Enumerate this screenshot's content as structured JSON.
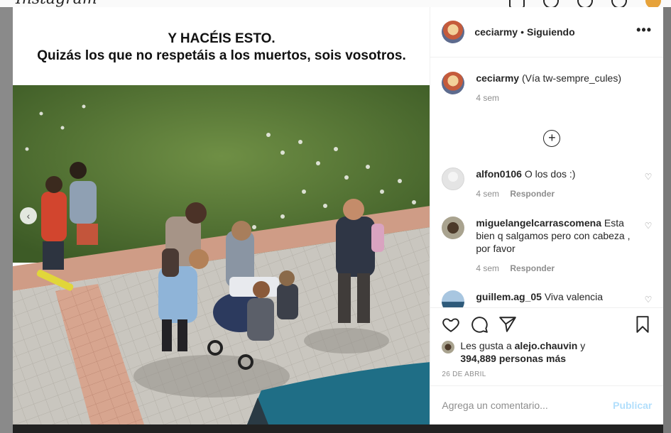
{
  "topbar": {
    "logo_text": "Instagram"
  },
  "post": {
    "caption_line1": "Y HACÉIS ESTO.",
    "caption_line2": "Quizás los que no respetáis a los muertos, sois vosotros."
  },
  "header": {
    "username": "ceciarmy",
    "separator": "•",
    "follow_status": "Siguiendo",
    "more_icon": "more-icon"
  },
  "author_caption": {
    "username": "ceciarmy",
    "text": "(Vía tw-sempre_cules)",
    "time": "4 sem"
  },
  "comments": [
    {
      "username": "alfon0106",
      "text": "O los dos :)",
      "time": "4 sem",
      "reply": "Responder"
    },
    {
      "username": "miguelangelcarrascomena",
      "text": "Esta bien q salgamos pero con cabeza , por favor",
      "time": "4 sem",
      "reply": "Responder"
    },
    {
      "username": "guillem.ag_05",
      "text": "Viva valencia"
    }
  ],
  "likes": {
    "prefix": "Les gusta a",
    "first_liker": "alejo.chauvin",
    "connector": "y",
    "others": "394,889 personas más"
  },
  "date": "26 DE ABRIL",
  "comment_box": {
    "placeholder": "Agrega un comentario...",
    "publish_label": "Publicar"
  },
  "colors": {
    "link_disabled": "#b2dffc",
    "secondary_text": "#8e8e8e",
    "border": "#efefef"
  }
}
